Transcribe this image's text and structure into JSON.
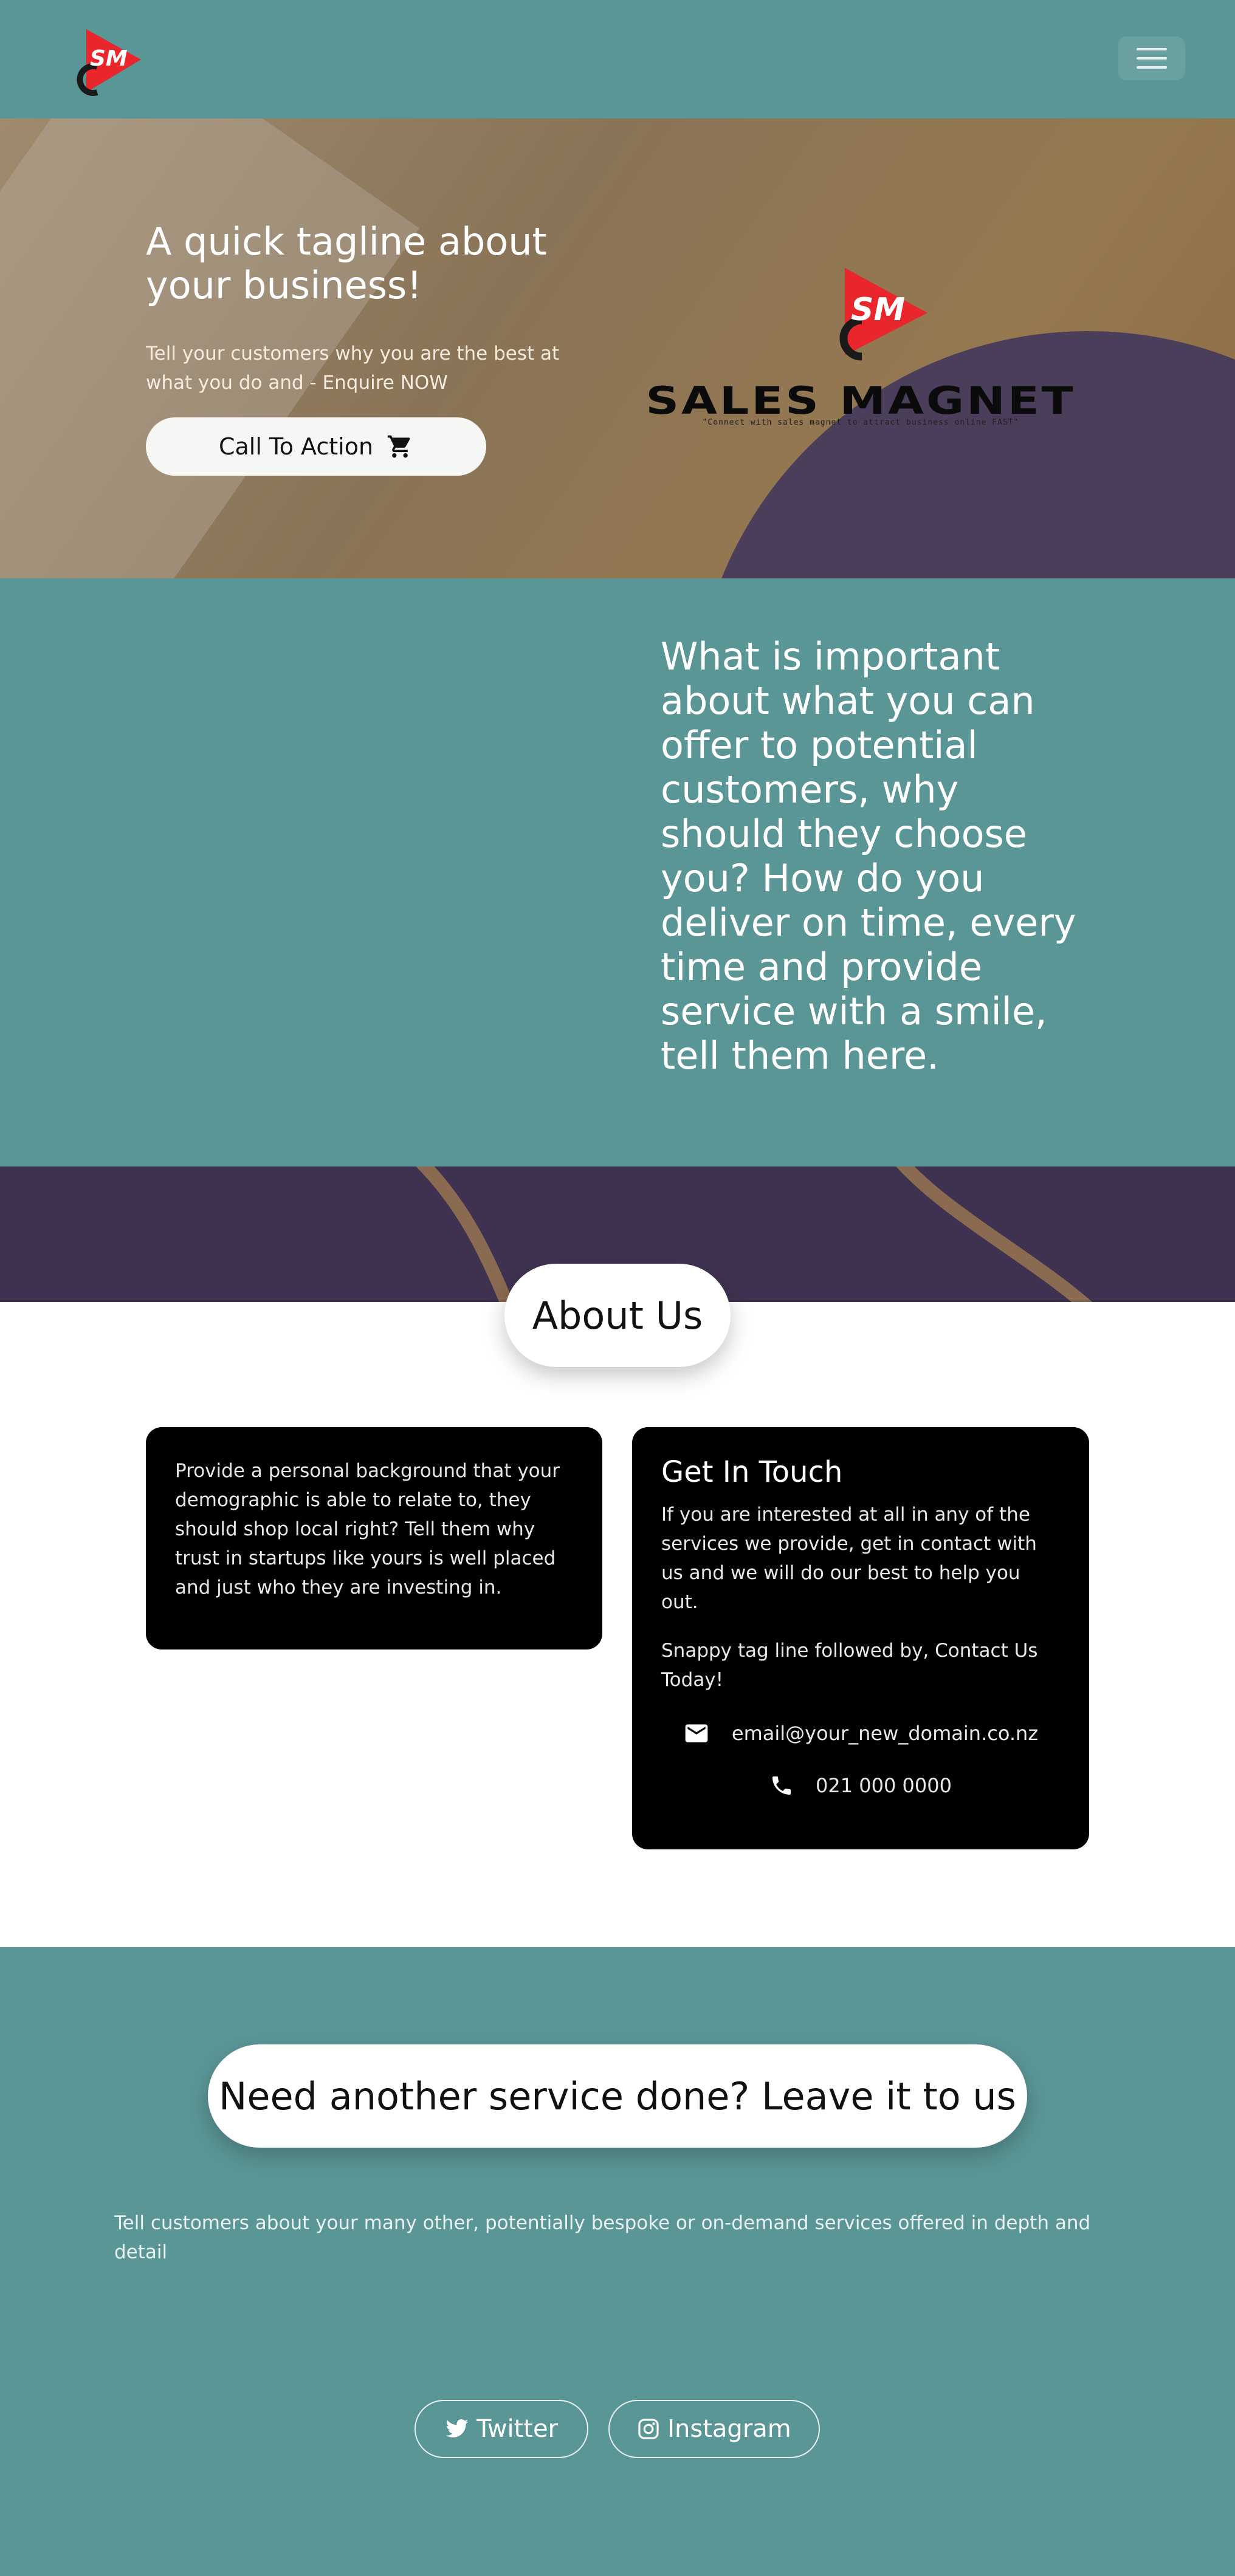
{
  "brand": {
    "name": "SALES MAGNET",
    "mark": "SM",
    "tagline": "\"Connect with sales magnet to attract business online FAST\""
  },
  "hero": {
    "tagline": "A quick tagline about your business!",
    "subtitle": "Tell your customers why you are the best at what you do and - Enquire NOW",
    "cta_label": "Call To Action"
  },
  "value": {
    "text": "What is important about what you can offer to potential customers, why should they choose you? How do you deliver on time, every time and provide service with a smile, tell them here."
  },
  "about": {
    "title": "About Us",
    "background_text": "Provide a personal background that your demographic is able to relate to, they should shop local right? Tell them why trust in startups like yours is well placed and just who they are investing in.",
    "contact": {
      "title": "Get In Touch",
      "text": "If you are interested at all in any of the services we provide, get in contact with us and we will do our best to help you out.",
      "tagline": "Snappy tag line followed by, Contact Us Today!",
      "email": "email@your_new_domain.co.nz",
      "phone": "021 000 0000"
    }
  },
  "services": {
    "title": "Need another service done? Leave it to us",
    "text": "Tell customers about your many other, potentially bespoke or on-demand services offered in depth and detail"
  },
  "social": {
    "twitter_label": "Twitter",
    "instagram_label": "Instagram"
  },
  "colors": {
    "teal": "#5b9696",
    "brand_red": "#e8262b",
    "card_black": "#000000",
    "band_purple": "#3f3250"
  }
}
